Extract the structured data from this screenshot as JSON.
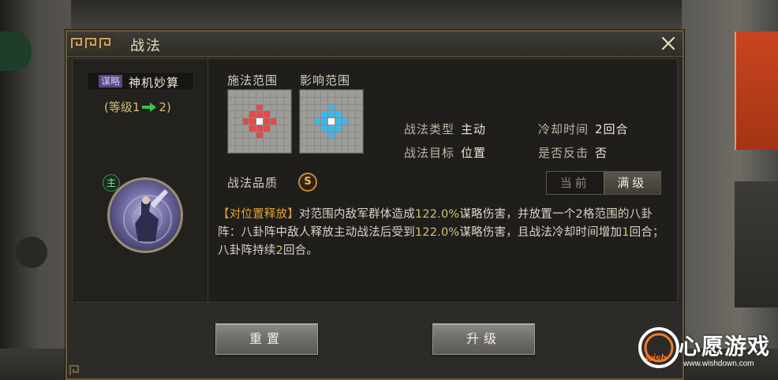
{
  "dialog": {
    "title": "战法",
    "close_icon": "close-icon"
  },
  "skill": {
    "type_tag": "谋略",
    "name": "神机妙算",
    "level_open": "(等级1",
    "level_close": "2)",
    "main_badge": "主"
  },
  "ranges": {
    "cast_label": "施法范围",
    "effect_label": "影响范围",
    "cast_color": "#e34b4b",
    "effect_color": "#3fb6e8"
  },
  "stats": {
    "type_key": "战法类型",
    "type_val": "主动",
    "target_key": "战法目标",
    "target_val": "位置",
    "cooldown_key": "冷却时间",
    "cooldown_val": "2回合",
    "counter_key": "是否反击",
    "counter_val": "否"
  },
  "quality": {
    "label": "战法品质",
    "grade": "S"
  },
  "toggle": {
    "current": "当前",
    "max": "满级",
    "selected": "满级"
  },
  "description": {
    "tag": "【对位置释放】",
    "p1": "对范围内敌军群体造成",
    "n1": "122.0%",
    "p2": "谋略伤害，并放置一个2格范围的八卦阵：八卦阵中敌人释放主动战法后受到",
    "n2": "122.0%",
    "p3": "谋略伤害，且战法冷却时间增加",
    "n3": "1",
    "p4": "回合；八卦阵持续",
    "n4": "2",
    "p5": "回合。"
  },
  "buttons": {
    "reset": "重置",
    "upgrade": "升级"
  },
  "watermark": {
    "title": "心愿游戏",
    "url": "www.wishdown.com",
    "logo_text": "wish"
  }
}
